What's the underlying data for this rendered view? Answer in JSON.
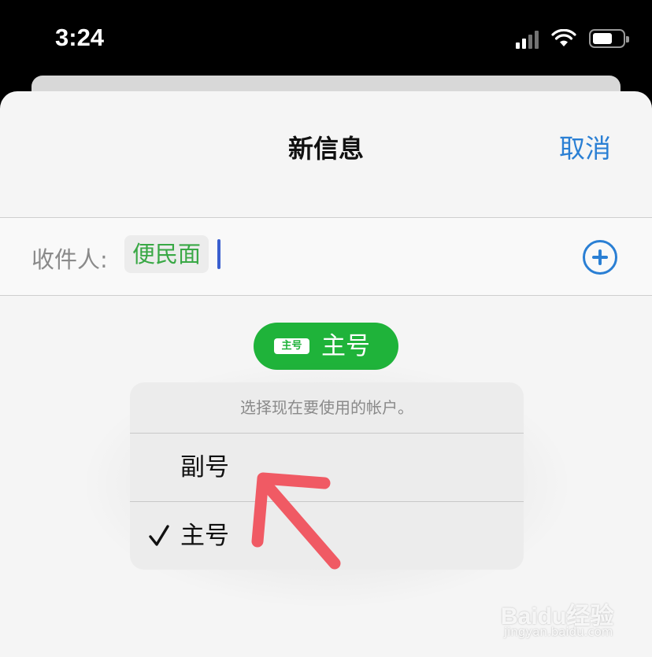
{
  "status_bar": {
    "time": "3:24",
    "icons": [
      "cellular-signal-icon",
      "wifi-icon",
      "battery-icon"
    ],
    "battery_level": 0.55
  },
  "sheet": {
    "title": "新信息",
    "cancel_label": "取消"
  },
  "recipient": {
    "label": "收件人:",
    "contact": "便民面",
    "add_icon": "plus-circle-icon"
  },
  "account_selector": {
    "badge": "主号",
    "label": "主号"
  },
  "account_menu": {
    "header": "选择现在要使用的帐户。",
    "items": [
      {
        "label": "副号",
        "checked": false
      },
      {
        "label": "主号",
        "checked": true
      }
    ]
  },
  "watermark": {
    "brand": "Baidu经验",
    "url": "jingyan.baidu.com"
  },
  "colors": {
    "accent": "#2a7fd4",
    "green": "#1fb33a",
    "annotation_arrow": "#f05a64"
  }
}
